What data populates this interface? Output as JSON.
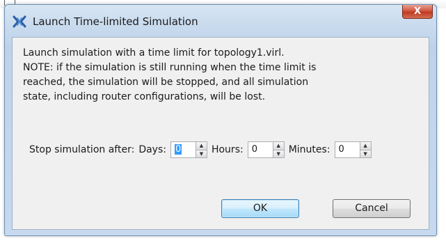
{
  "dialog": {
    "title": "Launch Time-limited Simulation",
    "close_label": "X",
    "message_lines": [
      "Launch simulation with a time limit for topology1.virl.",
      "NOTE: if the simulation is still running when the time limit is",
      "reached, the simulation will be stopped, and all simulation",
      "state, including router configurations, will be lost."
    ],
    "time_limit": {
      "prefix_label": "Stop simulation after:",
      "days_label": "Days:",
      "days_value": "0",
      "hours_label": "Hours:",
      "hours_value": "0",
      "minutes_label": "Minutes:",
      "minutes_value": "0"
    },
    "ok_label": "OK",
    "cancel_label": "Cancel"
  },
  "icons": {
    "title_icon": "virl-logo-icon",
    "spinner_up": "arrow-up-icon",
    "spinner_down": "arrow-down-icon"
  },
  "colors": {
    "close_button": "#c74a33",
    "selection": "#3399ff",
    "ok_border": "#3c7fb1"
  }
}
